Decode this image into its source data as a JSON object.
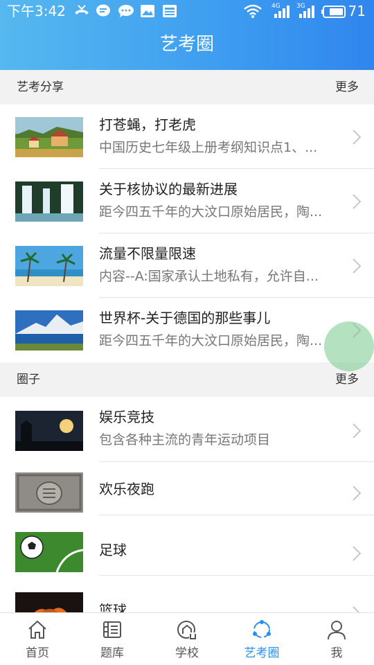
{
  "status_bar": {
    "time": "下午3:42",
    "network_1": "4G",
    "network_2": "3G",
    "battery": "71",
    "news_badge": "NEWS"
  },
  "header": {
    "title": "艺考圈"
  },
  "sections": [
    {
      "label": "艺考分享",
      "more": "更多",
      "items": [
        {
          "title": "打苍蝇，打老虎",
          "subtitle": "中国历史七年级上册考纲知识点1、...",
          "thumb": "painting-village"
        },
        {
          "title": "关于核协议的最新进展",
          "subtitle": "距今四五千年的大汶口原始居民，陶...",
          "thumb": "waterfall"
        },
        {
          "title": "流量不限量限速",
          "subtitle": "内容--A:国家承认土地私有，允许自...",
          "thumb": "beach-palms"
        },
        {
          "title": "世界杯-关于德国的那些事儿",
          "subtitle": "距今四五千年的大汶口原始居民，陶...",
          "thumb": "mountain-lake"
        }
      ]
    },
    {
      "label": "圈子",
      "more": "更多",
      "items": [
        {
          "title": "娱乐竞技",
          "subtitle": "包含各种主流的青年运动项目",
          "thumb": "sunset-silhouette"
        },
        {
          "title": "欢乐夜跑",
          "subtitle": "",
          "thumb": "stone-carving"
        },
        {
          "title": "足球",
          "subtitle": "",
          "thumb": "soccer-ball"
        },
        {
          "title": "篮球",
          "subtitle": "",
          "thumb": "basketball-fire"
        }
      ]
    }
  ],
  "tabs": [
    {
      "label": "首页",
      "icon": "home-icon",
      "active": false
    },
    {
      "label": "题库",
      "icon": "question-bank-icon",
      "active": false
    },
    {
      "label": "学校",
      "icon": "school-icon",
      "active": false
    },
    {
      "label": "艺考圈",
      "icon": "share-circle-icon",
      "active": true
    },
    {
      "label": "我",
      "icon": "person-icon",
      "active": false
    }
  ],
  "colors": {
    "header_start": "#56b8ef",
    "header_end": "#2f86ee",
    "active_tab": "#2a8ff0",
    "section_bg": "#f2f2f2"
  }
}
